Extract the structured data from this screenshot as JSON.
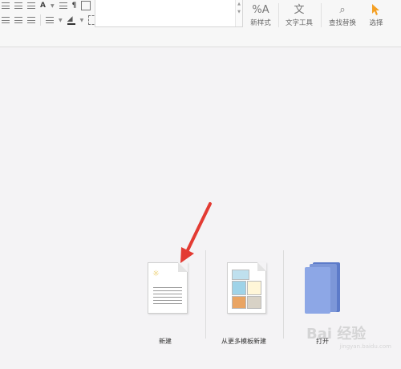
{
  "toolbar": {
    "row1_font_btn": "A",
    "stylebox_arrow_up": "▲",
    "stylebox_arrow_down": "▼",
    "buttons": {
      "new_style": "新样式",
      "text_tools": "文字工具",
      "find_replace": "查找替换",
      "select": "选择"
    }
  },
  "start": {
    "new_label": "新建",
    "template_label": "从更多模板新建",
    "open_label": "打开"
  },
  "watermark": {
    "text": "Bai 经验",
    "sub": "jingyan.baidu.com"
  },
  "colors": {
    "arrow": "#e33b33",
    "select_cursor": "#f4a024",
    "folder": "#7d97d8"
  }
}
